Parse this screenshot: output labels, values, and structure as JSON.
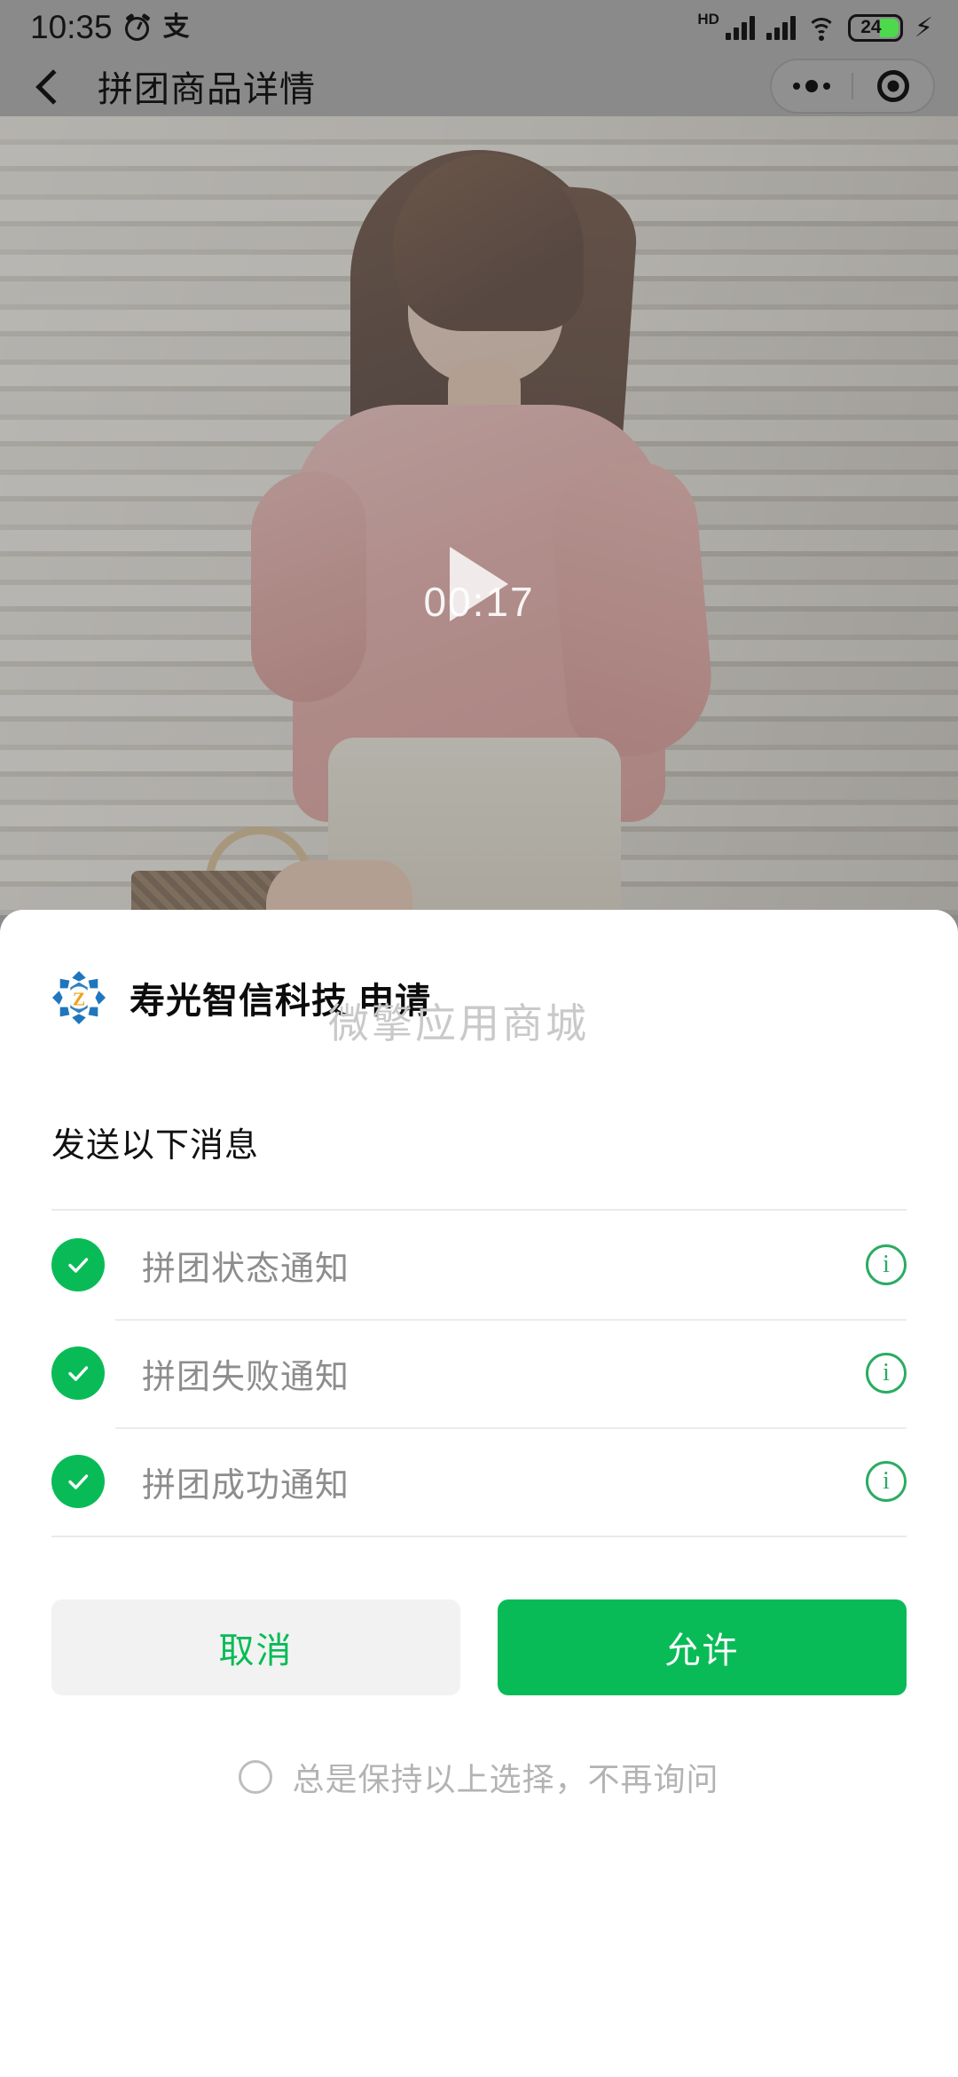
{
  "statusbar": {
    "time": "10:35",
    "alarm_icon": "alarm-clock-icon",
    "alipay_icon": "支",
    "hd_label": "HD",
    "wifi_icon": "wifi-icon",
    "battery_percent": "24",
    "charging_icon": "charging-bolt-icon"
  },
  "navbar": {
    "back_icon": "back-chevron-icon",
    "title": "拼团商品详情",
    "more_icon": "more-dots-icon",
    "close_icon": "target-close-icon"
  },
  "video": {
    "play_icon": "play-icon",
    "duration": "00:17"
  },
  "sheet": {
    "app_name": "寿光智信科技  申请",
    "logo_icon": "app-logo-icon",
    "logo_letter": "Z",
    "watermark": "微擎应用商城",
    "section_title": "发送以下消息",
    "permissions": [
      {
        "label": "拼团状态通知",
        "checked": true,
        "check_icon": "check-circle-icon",
        "info_icon": "info-icon",
        "info_glyph": "i"
      },
      {
        "label": "拼团失败通知",
        "checked": true,
        "check_icon": "check-circle-icon",
        "info_icon": "info-icon",
        "info_glyph": "i"
      },
      {
        "label": "拼团成功通知",
        "checked": true,
        "check_icon": "check-circle-icon",
        "info_icon": "info-icon",
        "info_glyph": "i"
      }
    ],
    "cancel_label": "取消",
    "allow_label": "允许",
    "always_label": "总是保持以上选择，不再询问",
    "always_checked": false
  },
  "colors": {
    "wechat_green": "#09bb57",
    "info_green": "#2bab62",
    "logo_blue": "#1f76bd",
    "logo_orange": "#f0a01e",
    "muted_text": "#8d8d8d",
    "watermark_grey": "#c9c9c9",
    "battery_green": "#4cd94c"
  }
}
